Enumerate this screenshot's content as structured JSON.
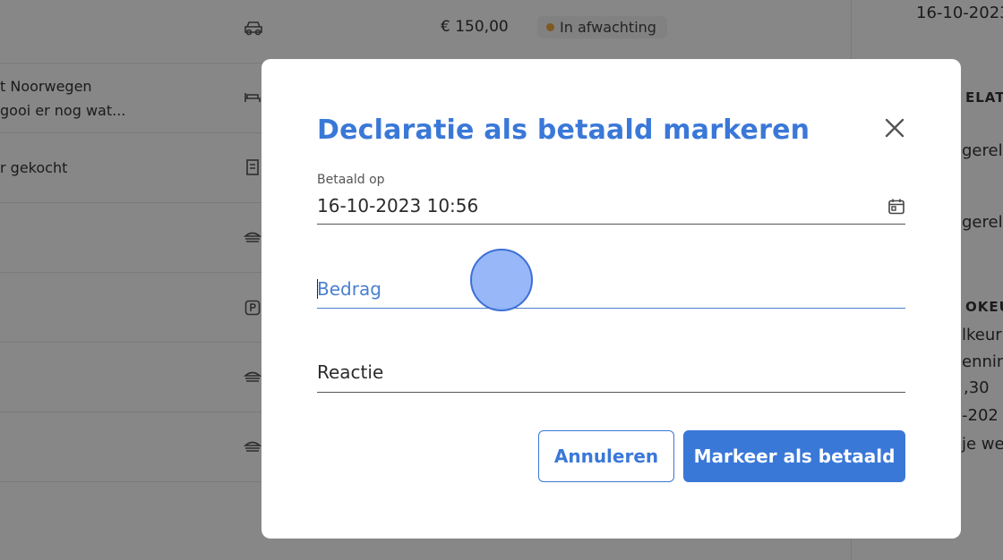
{
  "background": {
    "top_row": {
      "amount": "€ 150,00",
      "status": "In afwachting",
      "date": "16-10-2023"
    },
    "rows": [
      {
        "line1": "t Noorwegen",
        "line2": "gooi er nog wat...",
        "icon": "bed-icon"
      },
      {
        "line1": "r gekocht",
        "line2": "",
        "icon": "receipt-icon"
      },
      {
        "line1": "",
        "line2": "",
        "icon": "food-icon"
      },
      {
        "line1": "",
        "line2": "",
        "icon": "parking-icon"
      },
      {
        "line1": "",
        "line2": "",
        "icon": "food-icon"
      },
      {
        "line1": "",
        "line2": "",
        "icon": "food-icon"
      }
    ],
    "right_column": {
      "heading1": "ELATI",
      "text1": "gerela",
      "text2": "gerela",
      "heading2": "OKEU",
      "text3": "lkeuri",
      "text4": "ennin",
      "text5": ",30",
      "text6": "-202",
      "text7": "je we"
    }
  },
  "modal": {
    "title": "Declaratie als betaald markeren",
    "paid_on": {
      "label": "Betaald op",
      "value": "16-10-2023 10:56"
    },
    "amount": {
      "placeholder": "Bedrag"
    },
    "comment": {
      "placeholder": "Reactie"
    },
    "cancel_label": "Annuleren",
    "confirm_label": "Markeer als betaald"
  },
  "colors": {
    "accent": "#3a78d8",
    "status_dot": "#f0a640"
  }
}
